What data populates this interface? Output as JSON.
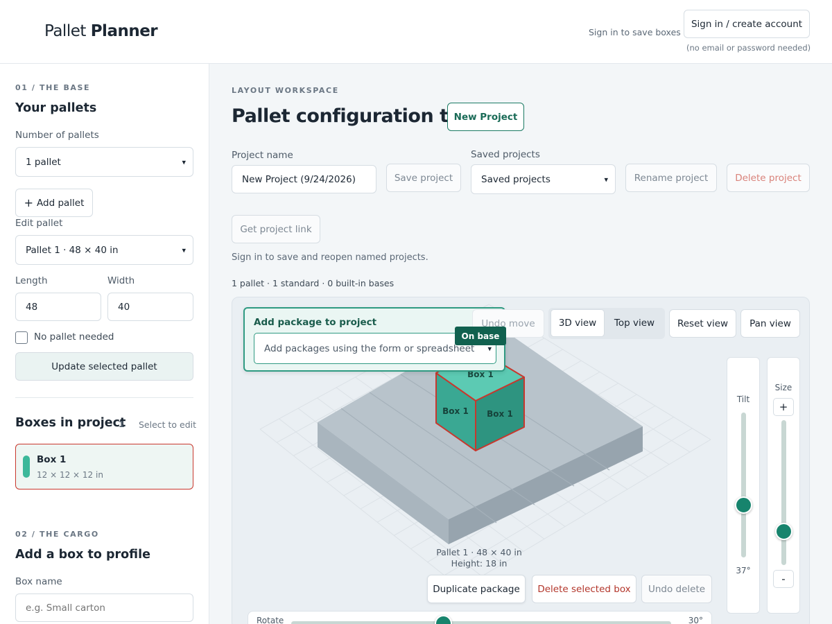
{
  "header": {
    "logo_light": "Pallet ",
    "logo_bold": "Planner",
    "signin_hint": "Sign in to save boxes",
    "signin_button": "Sign in / create account",
    "signin_note": "(no email or password needed)"
  },
  "sidebar": {
    "base_eyebrow": "01 / THE BASE",
    "base_title": "Your pallets",
    "num_pallets_label": "Number of pallets",
    "num_pallets_value": "1 pallet",
    "add_pallet_button": "Add pallet",
    "edit_pallet_label": "Edit pallet",
    "edit_pallet_value": "Pallet 1 · 48 × 40 in",
    "length_label": "Length",
    "length_value": "48",
    "width_label": "Width",
    "width_value": "40",
    "no_pallet_label": "No pallet needed",
    "update_button": "Update selected pallet",
    "boxes_title": "Boxes in project",
    "boxes_count": "1",
    "boxes_hint": "Select to edit",
    "boxes": [
      {
        "name": "Box 1",
        "dims": "12 × 12 × 12 in",
        "color": "#3cb89a"
      }
    ],
    "cargo_eyebrow": "02 / THE CARGO",
    "cargo_title": "Add a box to profile",
    "box_name_label": "Box name",
    "box_name_placeholder": "e.g. Small carton"
  },
  "main": {
    "eyebrow": "LAYOUT WORKSPACE",
    "title": "Pallet configuration tool",
    "new_project_button": "New Project",
    "project_name_label": "Project name",
    "project_name_value": "New Project (9/24/2026)",
    "save_project_button": "Save project",
    "saved_projects_label": "Saved projects",
    "saved_projects_value": "Saved projects",
    "rename_button": "Rename project",
    "delete_button": "Delete project",
    "link_button": "Get project link",
    "signin_note": "Sign in to save and reopen named projects.",
    "summary": "1 pallet · 1 standard · 0 built-in bases"
  },
  "workspace": {
    "package_panel_title": "Add package to project",
    "package_select": "Add packages using the form or spreadsheet",
    "on_base_badge": "On base",
    "undo_move": "Undo move",
    "view_3d": "3D view",
    "view_top": "Top view",
    "reset_view": "Reset view",
    "pan_view": "Pan view",
    "box_label": "Box 1",
    "tilt_label": "Tilt",
    "tilt_value": "37°",
    "size_label": "Size",
    "zoom_in": "+",
    "zoom_out": "-",
    "pallet_info_1": "Pallet 1 · 48 × 40 in",
    "pallet_info_2": "Height: 18 in",
    "duplicate_button": "Duplicate package",
    "delete_box_button": "Delete selected box",
    "undo_delete_button": "Undo delete",
    "rotate_label": "Rotate",
    "rotate_value": "30°",
    "tilt_fraction": 0.64,
    "size_fraction": 0.77,
    "rotate_fraction": 0.4,
    "colors": {
      "accent": "#17846d",
      "box_front": "#3aa893",
      "box_side": "#2e9480",
      "box_top": "#5ccab3",
      "selected_outline": "#c8372d",
      "pallet_top": "#b8c3cb",
      "pallet_left": "#a9b5be",
      "pallet_right": "#97a4ae"
    }
  }
}
